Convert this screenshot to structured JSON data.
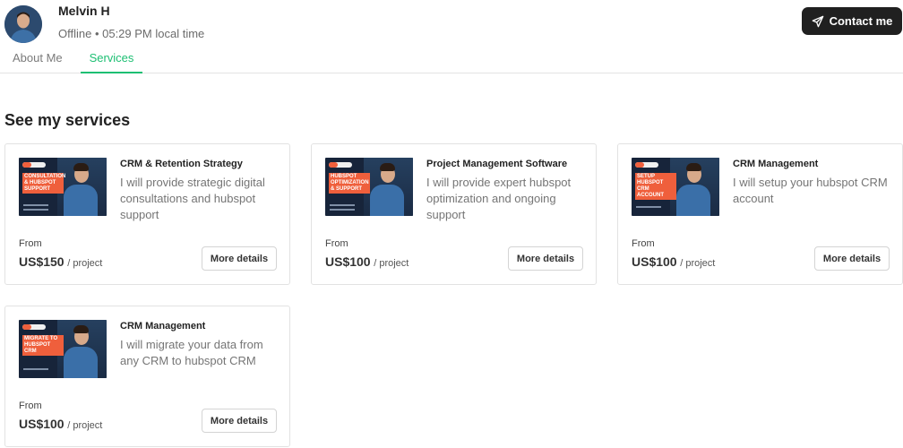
{
  "profile": {
    "name": "Melvin H",
    "status": "Offline • 05:29 PM local time",
    "contact_label": "Contact me"
  },
  "tabs": [
    {
      "label": "About Me",
      "active": false
    },
    {
      "label": "Services",
      "active": true
    }
  ],
  "colors": {
    "accent": "#1dbf73",
    "button_dark": "#202020",
    "thumb_orange": "#ef5f3c"
  },
  "section": {
    "title": "See my services"
  },
  "services": [
    {
      "title": "CRM & Retention Strategy",
      "description": "I will provide strategic digital consultations and hubspot support",
      "from_label": "From",
      "price": "US$150",
      "unit": "/ project",
      "button": "More details",
      "thumb_text": "Consultation & Hubspot Support"
    },
    {
      "title": "Project Management Software",
      "description": "I will provide expert hubspot optimization and ongoing support",
      "from_label": "From",
      "price": "US$100",
      "unit": "/ project",
      "button": "More details",
      "thumb_text": "Hubspot Optimization & Support"
    },
    {
      "title": "CRM Management",
      "description": "I will setup your hubspot CRM account",
      "from_label": "From",
      "price": "US$100",
      "unit": "/ project",
      "button": "More details",
      "thumb_text": "Setup Hubspot CRM Account"
    },
    {
      "title": "CRM Management",
      "description": "I will migrate your data from any CRM to hubspot CRM",
      "from_label": "From",
      "price": "US$100",
      "unit": "/ project",
      "button": "More details",
      "thumb_text": "Migrate to Hubspot CRM"
    }
  ]
}
